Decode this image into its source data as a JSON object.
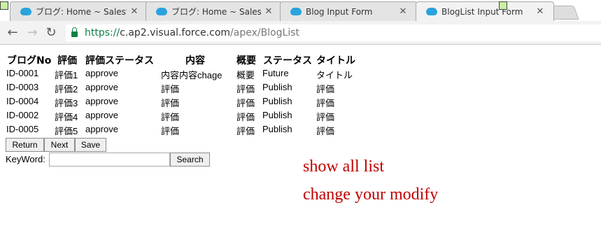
{
  "browser": {
    "tabs": [
      {
        "title": "ブログ: Home ~ Salesfo",
        "close": "✕"
      },
      {
        "title": "ブログ: Home ~ Salesfo",
        "close": "✕"
      },
      {
        "title": "Blog Input Form",
        "close": "✕"
      },
      {
        "title": "BlogList Input Form",
        "close": "✕"
      }
    ],
    "nav": {
      "back": "←",
      "forward": "→",
      "reload": "↻"
    },
    "url": {
      "scheme": "https://",
      "host": "c.ap2.visual.force.com",
      "path": "/apex/BlogList"
    }
  },
  "table": {
    "headers": [
      "ブログNo",
      "評価",
      "評価ステータス",
      "内容",
      "概要",
      "ステータス",
      "タイトル"
    ],
    "rows": [
      [
        "ID-0001",
        "評価1",
        "approve",
        "内容内容chage",
        "概要",
        "Future",
        "タイトル"
      ],
      [
        "ID-0003",
        "評価2",
        "approve",
        "評価",
        "評価",
        "Publish",
        "評価"
      ],
      [
        "ID-0004",
        "評価3",
        "approve",
        "評価",
        "評価",
        "Publish",
        "評価"
      ],
      [
        "ID-0002",
        "評価4",
        "approve",
        "評価",
        "評価",
        "Publish",
        "評価"
      ],
      [
        "ID-0005",
        "評価5",
        "approve",
        "評価",
        "評価",
        "Publish",
        "評価"
      ]
    ]
  },
  "buttons": {
    "return": "Return",
    "next": "Next",
    "save": "Save"
  },
  "search": {
    "label": "KeyWord:",
    "value": "",
    "button": "Search"
  },
  "notes": [
    "show all list",
    "change your modify"
  ]
}
